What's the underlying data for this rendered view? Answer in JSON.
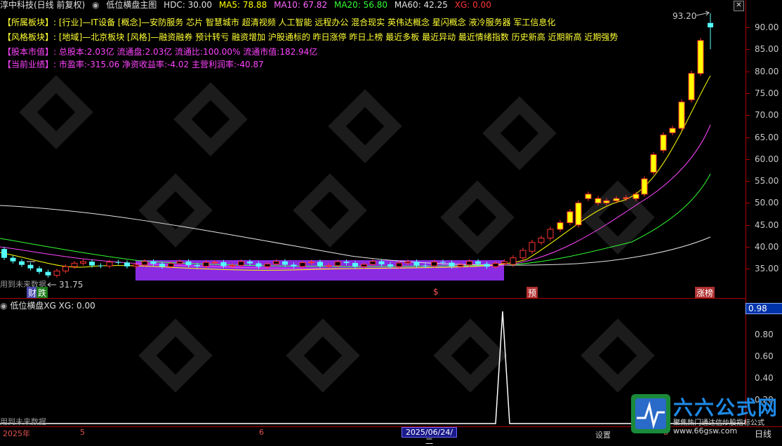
{
  "title": {
    "stock": "淳中科技(日线 前复权)",
    "indicator": "低位横盘主图",
    "hdc": "HDC: 30.00",
    "ma5": "MA5: 78.88",
    "ma10": "MA10: 67.82",
    "ma20": "MA20: 56.80",
    "ma60": "MA60: 42.25",
    "xg": "XG: 0.00"
  },
  "info": {
    "sector_label": "【所属板块】:",
    "sector_value": "[行业]—IT设备 [概念]—安防服务 芯片 智慧城市 超清视频 人工智能 远程办公 混合现实 英伟达概念 星闪概念 液冷服务器 军工信息化",
    "style_label": "【风格板块】:",
    "style_value": "[地域]—北京板块 [风格]—融资融券 预计转亏 融资增加 沪股通标的 昨日涨停 昨日上榜 最近多板 最近异动 最近情绪指数 历史新高 近期新高 近期强势",
    "equity_label": "【股本市值】:",
    "equity_value": "总股本:2.03亿 流通盘:2.03亿 流通比:100.00% 流通市值:182.94亿",
    "perf_label": "【当前业绩】:",
    "perf_value": "市盈率:-315.06 净资收益率:-4.02 主营利润率:-40.87"
  },
  "main_axis": {
    "labels": [
      "90.00",
      "85.00",
      "80.00",
      "75.00",
      "70.00",
      "65.00",
      "60.00",
      "55.00",
      "50.00",
      "45.00",
      "40.00",
      "35.00"
    ],
    "high_label": "93.20",
    "low_label": "31.75"
  },
  "markers": {
    "caibao": "财",
    "die": "跌",
    "dollar": "$",
    "yu": "预",
    "zhangbang": "涨榜"
  },
  "future_note_top": "用到未来数据",
  "sub": {
    "title": "低位横盘XG",
    "xg": "XG: 0.00",
    "value_box": "0.98",
    "labels": [
      "0.80",
      "0.60",
      "0.40",
      "0.20"
    ],
    "future_note": "用到未来数据"
  },
  "bottom": {
    "year": "2025年",
    "m5": "5",
    "m6": "6",
    "selected_date": "2025/06/24/二",
    "m8": "8",
    "period": "日线",
    "settings": "设置"
  },
  "logo": {
    "name": "六六公式网",
    "slogan": "聚焦热门通达信炒股指标公式",
    "url": "www.66gsw.com"
  },
  "colors": {
    "up": "#ff3333",
    "down": "#54ffff",
    "ma5": "#ffff00",
    "ma10": "#ff00ff",
    "ma20": "#00ff00",
    "ma60": "#ffffff",
    "zone": "#8a2be2",
    "label_yellow": "#ffff33",
    "label_magenta": "#ff44ff"
  }
}
